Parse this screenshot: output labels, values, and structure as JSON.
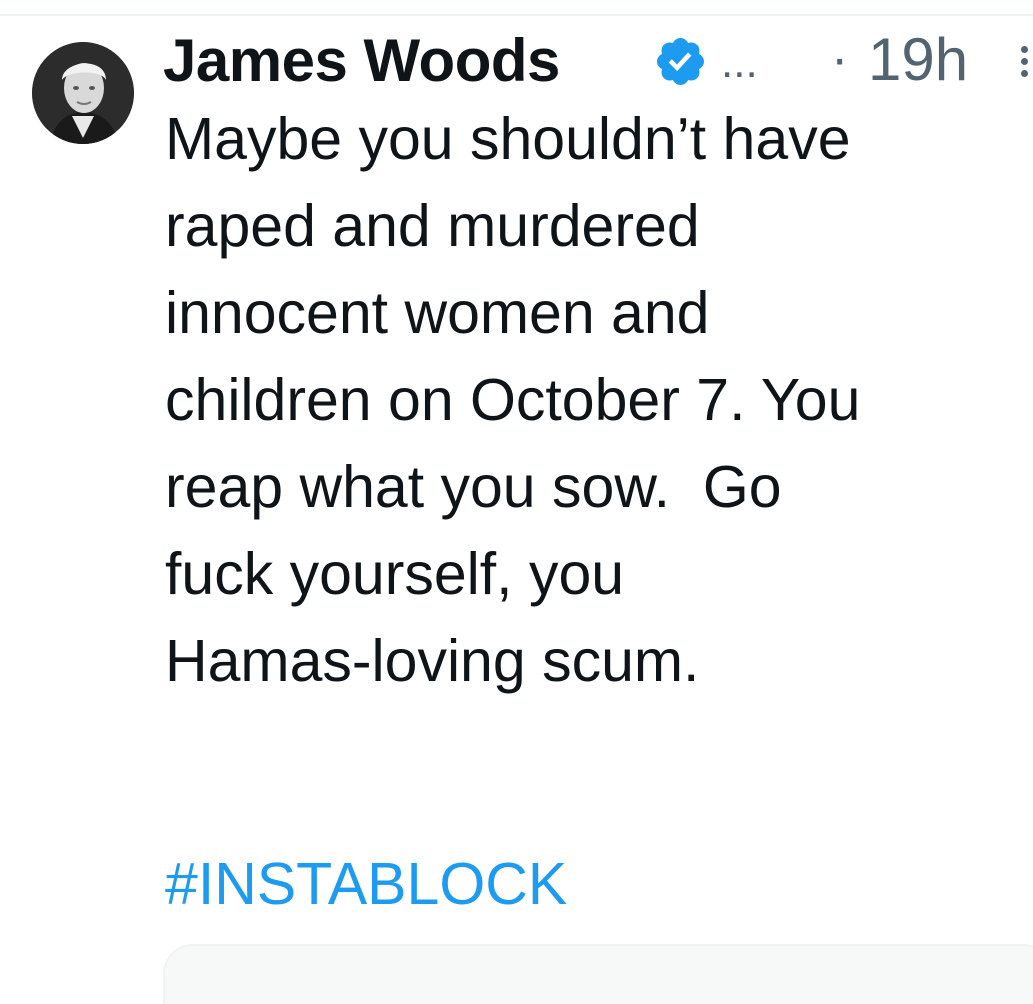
{
  "tweet": {
    "author": {
      "display_name": "James Woods",
      "verified_icon": "verified-badge-icon",
      "overflow": "...",
      "avatar_icon": "avatar-photo"
    },
    "separator": "·",
    "timestamp": "19h",
    "more_icon": "more-options-icon",
    "text_lines": [
      "Maybe you shouldn’t have",
      "raped and murdered",
      "innocent women and",
      "children on October 7. You",
      "reap what you sow.  Go",
      "fuck yourself, you",
      "Hamas-loving scum."
    ],
    "hashtag": "#INSTABLOCK"
  },
  "colors": {
    "text": "#0f1419",
    "secondary": "#536471",
    "accent": "#1d9bf0",
    "divider": "#eff3f4"
  }
}
